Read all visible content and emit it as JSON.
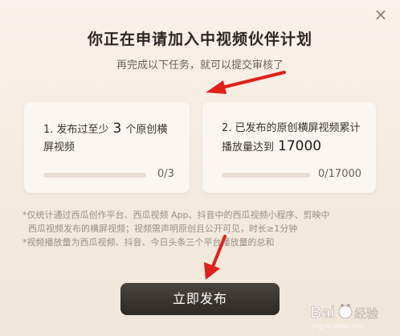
{
  "dialog": {
    "close_label": "×",
    "title": "你正在申请加入中视频伙伴计划",
    "subtitle": "再完成以下任务，就可以提交审核了"
  },
  "tasks": [
    {
      "prefix": "1. 发布过至少",
      "number": "3",
      "suffix": "个原创横屏视频",
      "progress_text": "0/3",
      "progress": 0
    },
    {
      "prefix": "2. 已发布的原创横屏视频累计播放量达到",
      "number": "17000",
      "suffix": "",
      "progress_text": "0/17000",
      "progress": 0
    }
  ],
  "notes": [
    "*仅统计通过西瓜创作平台、西瓜视频 App、抖音中的西瓜视频小程序、剪映中",
    "  西瓜视频发布的横屏视频；视频需声明原创且公开可见，时长≥1分钟",
    "*视频播放量为西瓜视频、抖音、今日头条三个平台播放量的总和"
  ],
  "publish_button": "立即发布",
  "watermark": {
    "brand": "Bai",
    "brand_suffix": "经验",
    "url": "jingyan.baidu.com"
  },
  "colors": {
    "annotation_arrow": "#e0201c",
    "button_bg": "#2e2925",
    "progress_track": "#e8ddd2"
  }
}
